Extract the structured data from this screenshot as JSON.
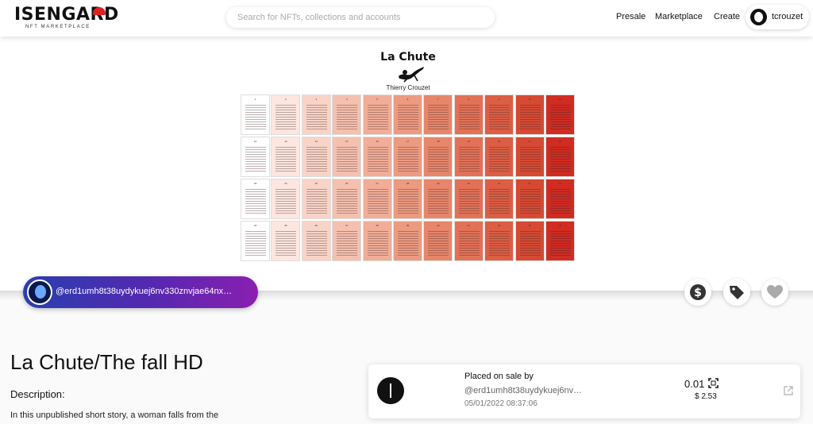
{
  "header": {
    "logo_text": "ISENGARD",
    "logo_subtext": "NFT MARKETPLACE",
    "search_placeholder": "Search for NFTs, collections and accounts",
    "nav": [
      "Presale",
      "Marketplace",
      "Create"
    ],
    "username": "tcrouzet"
  },
  "artwork": {
    "title": "La Chute",
    "author": "Thierry Crouzet",
    "page_rows": [
      [
        "1",
        "2",
        "3",
        "4",
        "5",
        "6",
        "7",
        "8",
        "9",
        "10",
        "11"
      ],
      [
        "12",
        "13",
        "14",
        "15",
        "16",
        "17",
        "18",
        "19",
        "20",
        "21",
        "22"
      ],
      [
        "23",
        "24",
        "25",
        "26",
        "27",
        "28",
        "29",
        "30",
        "31",
        "32",
        "33"
      ],
      [
        "34",
        "35",
        "36",
        "37",
        "38",
        "39",
        "40",
        "41",
        "42",
        "43",
        "44"
      ]
    ],
    "column_colors": [
      "#ffffff",
      "#fde6df",
      "#f9d3c7",
      "#f5c0ae",
      "#f1ad97",
      "#ec9a80",
      "#e7866b",
      "#e27257",
      "#dc5e44",
      "#d64a33",
      "#d02c22"
    ]
  },
  "owner": {
    "address": "@erd1umh8t38uydykuej6nv330znvjae64nx…"
  },
  "actions": {
    "icons": [
      "dollar-icon",
      "tag-icon",
      "heart-icon"
    ]
  },
  "nft": {
    "title": "La Chute/The fall HD",
    "description_label": "Description:",
    "description_text": "In this unpublished short story, a woman falls from the"
  },
  "sale": {
    "label": "Placed on sale by",
    "user": "@erd1umh8t38uydykuej6nv…",
    "date": "05/01/2022 08:37:06",
    "amount": "0.01",
    "usd": "$ 2.53"
  },
  "colors": {
    "owner_gradient": [
      "#2a3fb0",
      "#8a1fb0"
    ],
    "accent_red": "#d02c22"
  }
}
